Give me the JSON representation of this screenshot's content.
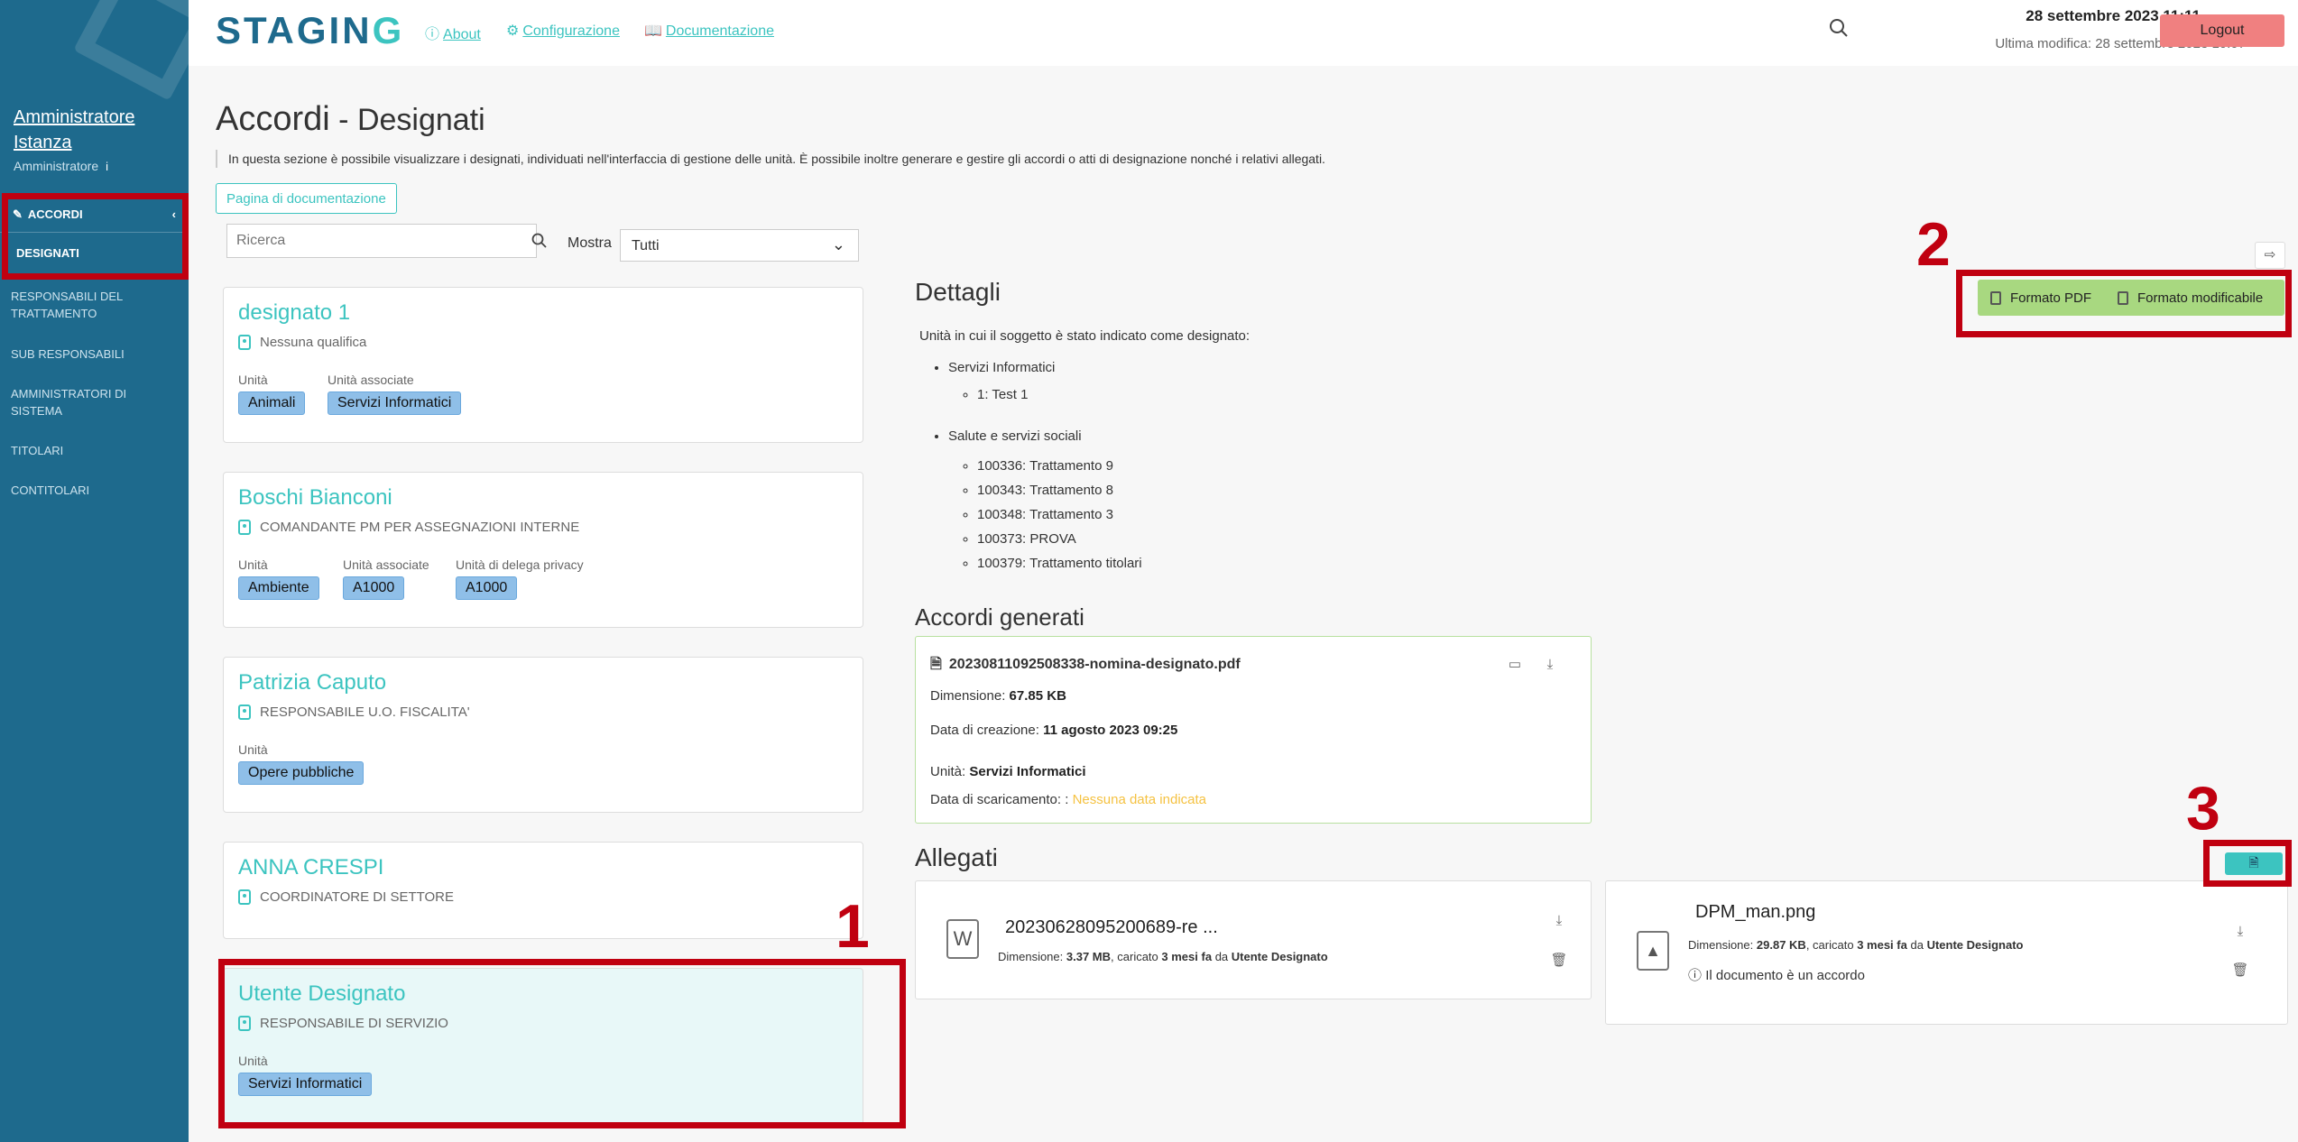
{
  "app": {
    "logo": "STAGING",
    "links": [
      "About",
      "Configurazione",
      "Documentazione"
    ],
    "date": "28 settembre 2023 11:11",
    "last_modified": "Ultima modifica: 28 settembre 2023 10:07",
    "logout": "Logout"
  },
  "sidebar": {
    "user_name": "Amministratore Istanza",
    "user_role": "Amministratore",
    "info": "i",
    "section": "ACCORDI",
    "sub_item": "DESIGNATI",
    "items": [
      "RESPONSABILI DEL TRATTAMENTO",
      "SUB RESPONSABILI",
      "AMMINISTRATORI DI SISTEMA",
      "TITOLARI",
      "CONTITOLARI"
    ]
  },
  "page": {
    "title": "Accordi",
    "separator": " - ",
    "subtitle": "Designati",
    "description": "In questa sezione è possibile visualizzare i designati, individuati nell'interfaccia di gestione delle unità. È possibile inoltre generare e gestire gli accordi o atti di designazione nonché i relativi allegati.",
    "doc_button": "Pagina di documentazione",
    "search_placeholder": "Ricerca",
    "show_label": "Mostra",
    "show_value": "Tutti"
  },
  "cards": [
    {
      "name": "designato 1",
      "qualifica": "Nessuna qualifica",
      "groups": [
        {
          "label": "Unità",
          "tags": [
            "Animali"
          ]
        },
        {
          "label": "Unità associate",
          "tags": [
            "Servizi Informatici"
          ]
        }
      ]
    },
    {
      "name": "Boschi Bianconi",
      "qualifica": "COMANDANTE PM PER ASSEGNAZIONI INTERNE",
      "groups": [
        {
          "label": "Unità",
          "tags": [
            "Ambiente"
          ]
        },
        {
          "label": "Unità associate",
          "tags": [
            "A1000"
          ]
        },
        {
          "label": "Unità di delega privacy",
          "tags": [
            "A1000"
          ]
        }
      ]
    },
    {
      "name": "Patrizia Caputo",
      "qualifica": "RESPONSABILE U.O. FISCALITA'",
      "groups": [
        {
          "label": "Unità",
          "tags": [
            "Opere pubbliche"
          ]
        }
      ]
    },
    {
      "name": "ANNA CRESPI",
      "qualifica": "COORDINATORE DI SETTORE",
      "groups": []
    },
    {
      "name": "Utente Designato",
      "qualifica": "RESPONSABILE DI SERVIZIO",
      "groups": [
        {
          "label": "Unità",
          "tags": [
            "Servizi Informatici"
          ]
        }
      ]
    }
  ],
  "details": {
    "title": "Dettagli",
    "intro": "Unità in cui il soggetto è stato indicato come designato:",
    "units": [
      {
        "name": "Servizi Informatici",
        "items": [
          "1: Test 1"
        ]
      },
      {
        "name": "Salute e servizi sociali",
        "items": [
          "100336: Trattamento 9",
          "100343: Trattamento 8",
          "100348: Trattamento 3",
          "100373: PROVA",
          "100379: Trattamento titolari"
        ]
      }
    ]
  },
  "format_buttons": {
    "pdf": "Formato PDF",
    "editable": "Formato modificabile"
  },
  "accordi": {
    "title": "Accordi generati",
    "file": "20230811092508338-nomina-designato.pdf",
    "dim_label": "Dimensione:",
    "dim_value": "67.85 KB",
    "created_label": "Data di creazione:",
    "created_value": "11 agosto 2023 09:25",
    "unit_label": "Unità:",
    "unit_value": "Servizi Informatici",
    "download_label": "Data di scaricamento: :",
    "download_value": "Nessuna data indicata"
  },
  "allegati": {
    "title": "Allegati",
    "files": [
      {
        "name": "20230628095200689-re ...",
        "dim": "3.37 MB",
        "when": "3 mesi fa",
        "by": "Utente Designato",
        "note": ""
      },
      {
        "name": "DPM_man.png",
        "dim": "29.87 KB",
        "when": "3 mesi fa",
        "by": "Utente Designato",
        "note": "Il documento è un accordo"
      }
    ],
    "meta_dim": "Dimensione:",
    "meta_uploaded": ", caricato",
    "meta_by": "da"
  },
  "annotations": [
    "1",
    "2",
    "3"
  ],
  "colors": {
    "sidebar": "#1e6a8d",
    "accent": "#3cc4c0",
    "tag": "#8fbfe8",
    "annotation": "#c00010",
    "format_bar": "#a8d880",
    "logout": "#f08080"
  }
}
